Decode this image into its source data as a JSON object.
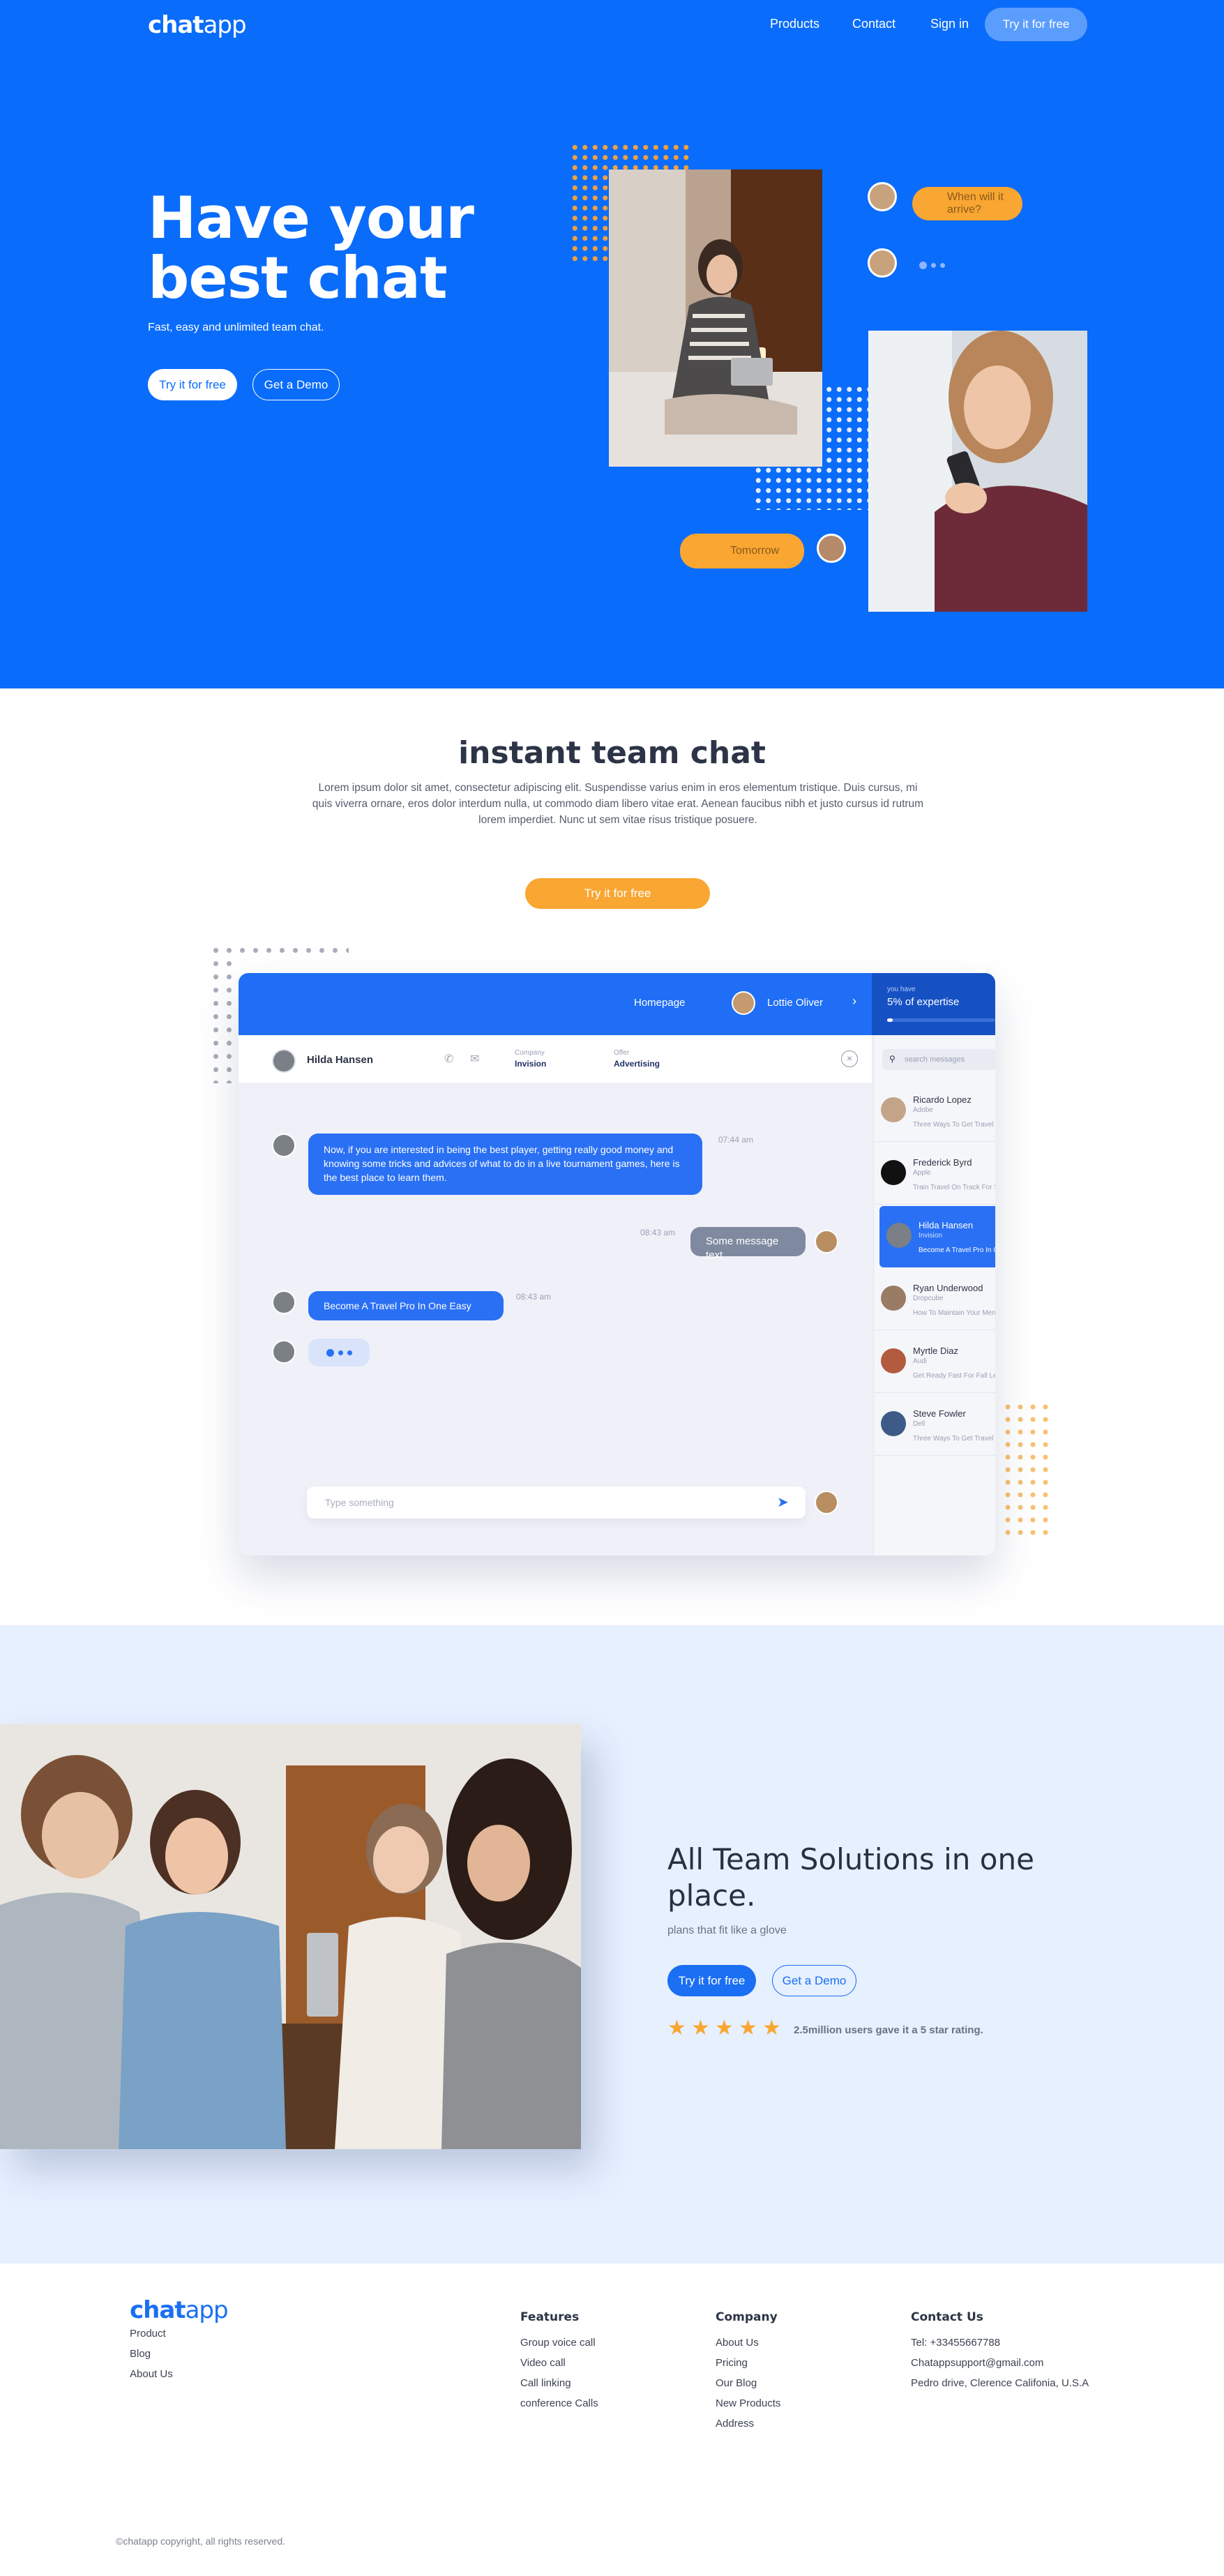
{
  "brand": {
    "logo_bold": "chat",
    "logo_light": "app"
  },
  "nav": {
    "products": "Products",
    "contact": "Contact",
    "sign_in": "Sign in",
    "try": "Try it for free"
  },
  "hero": {
    "title_line1": "Have your",
    "title_line2": "best chat",
    "subtitle": "Fast, easy and unlimited team chat.",
    "primary_button": "Try it for free",
    "secondary_button": "Get a Demo",
    "bubble_question": "When will it arrive?",
    "bubble_answer": "Tomorrow"
  },
  "intro": {
    "title": "instant team chat",
    "body": "Lorem ipsum dolor sit amet, consectetur adipiscing elit. Suspendisse varius enim in eros elementum tristique. Duis cursus, mi quis viverra ornare, eros dolor interdum nulla, ut commodo diam libero vitae erat. Aenean faucibus nibh et justo cursus id rutrum lorem imperdiet. Nunc ut sem vitae risus tristique posuere.",
    "button": "Try it for free"
  },
  "app": {
    "topbar_link": "Homepage",
    "topbar_user": "Lottie Oliver",
    "expertise_small": "you have",
    "expertise_big": "5% of expertise",
    "contact_name": "Hilda Hansen",
    "company_label": "Company",
    "company_value": "Invision",
    "offer_label": "Offer",
    "offer_value": "Advertising",
    "search_placeholder": "search messages",
    "msg1": "Now, if you are interested in being the best player, getting really good money and knowing some tricks and advices of what to do in a live tournament games, here is the best place to learn them.",
    "msg1_time": "07:44 am",
    "msg2": "Some message text",
    "msg2_time": "08:43 am",
    "msg3": "Become A Travel Pro In One Easy",
    "msg3_time": "08:43 am",
    "input_placeholder": "Type something",
    "contacts": [
      {
        "name": "Ricardo Lopez",
        "company": "Adobe",
        "text": "Three Ways To Get Travel Disc"
      },
      {
        "name": "Frederick Byrd",
        "company": "Apple",
        "text": "Train Travel On Track For Safe"
      },
      {
        "name": "Hilda Hansen",
        "company": "Invision",
        "text": "Become A Travel Pro In One"
      },
      {
        "name": "Ryan Underwood",
        "company": "Dropcube",
        "text": "How To Maintain Your Mental"
      },
      {
        "name": "Myrtle Diaz",
        "company": "Audi",
        "text": "Get Ready Fast For Fall Leaf"
      },
      {
        "name": "Steve Fowler",
        "company": "Dell",
        "text": "Three Ways To Get Travel Disc"
      }
    ]
  },
  "solutions": {
    "title_line1": "All Team Solutions in one",
    "title_line2": "place.",
    "subtitle": "plans that fit like a glove",
    "primary_button": "Try it for free",
    "secondary_button": "Get a Demo",
    "rating_text": "2.5million users gave it a 5 star rating.",
    "stars": 5
  },
  "footer": {
    "links": [
      "Product",
      "Blog",
      "About Us"
    ],
    "features_title": "Features",
    "features": [
      "Group voice call",
      "Video call",
      "Call linking",
      "conference Calls"
    ],
    "company_title": "Company",
    "company": [
      "About Us",
      "Pricing",
      "Our Blog",
      "New Products",
      "Address"
    ],
    "contact_title": "Contact Us",
    "contact": [
      "Tel: +33455667788",
      "Chatappsupport@gmail.com",
      "Pedro drive, Clerence Califonia, U.S.A"
    ],
    "copyright": "©chatapp copyright, all rights reserved."
  },
  "colors": {
    "primary": "#0a6cfb",
    "accent": "#f9a632",
    "light_bg": "#e7f0ff",
    "text": "#27313f"
  }
}
